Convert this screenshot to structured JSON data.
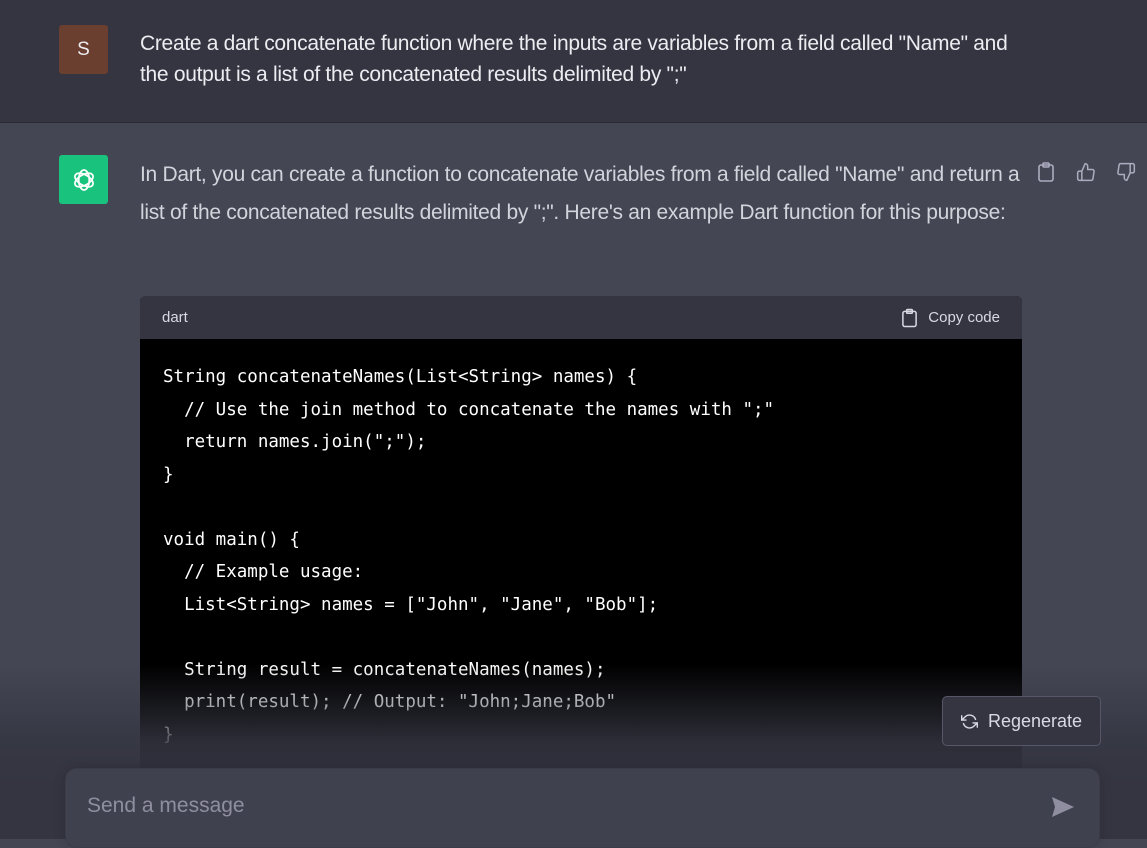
{
  "user_message": {
    "avatar_letter": "S",
    "text": "Create a dart concatenate function where the inputs are variables from a field called \"Name\" and the output is a list of the concatenated results delimited by \";\""
  },
  "assistant_message": {
    "avatar_icon": "openai-logo-icon",
    "text": "In Dart, you can create a function to concatenate variables from a field called \"Name\" and return a list of the concatenated results delimited by \";\". Here's an example Dart function for this purpose:",
    "actions": [
      "clipboard-icon",
      "thumbs-up-icon",
      "thumbs-down-icon"
    ],
    "code_block": {
      "language": "dart",
      "copy_label": "Copy code",
      "code": "String concatenateNames(List<String> names) {\n  // Use the join method to concatenate the names with \";\"\n  return names.join(\";\");\n}\n\nvoid main() {\n  // Example usage:\n  List<String> names = [\"John\", \"Jane\", \"Bob\"];\n\n  String result = concatenateNames(names);\n  print(result); // Output: \"John;Jane;Bob\"\n}"
    }
  },
  "regenerate": {
    "label": "Regenerate"
  },
  "composer": {
    "placeholder": "Send a message"
  },
  "colors": {
    "background": "#444654",
    "user_bg": "#343541",
    "bot_avatar": "#19c37d",
    "user_avatar": "#6b3f2f",
    "code_bg": "#000000"
  }
}
